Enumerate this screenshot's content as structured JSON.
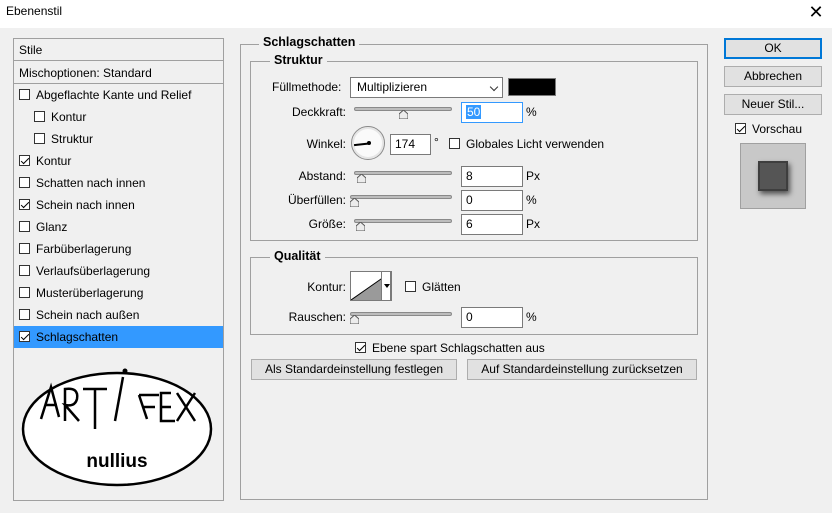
{
  "window": {
    "title": "Ebenenstil",
    "close_icon": "close-icon"
  },
  "style_list": {
    "header": "Stile",
    "blending": "Mischoptionen: Standard",
    "items": [
      {
        "label": "Abgeflachte Kante und Relief",
        "checked": false,
        "indent": false,
        "selected": false
      },
      {
        "label": "Kontur",
        "checked": false,
        "indent": true,
        "selected": false
      },
      {
        "label": "Struktur",
        "checked": false,
        "indent": true,
        "selected": false
      },
      {
        "label": "Kontur",
        "checked": true,
        "indent": false,
        "selected": false
      },
      {
        "label": "Schatten nach innen",
        "checked": false,
        "indent": false,
        "selected": false
      },
      {
        "label": "Schein nach innen",
        "checked": true,
        "indent": false,
        "selected": false
      },
      {
        "label": "Glanz",
        "checked": false,
        "indent": false,
        "selected": false
      },
      {
        "label": "Farbüberlagerung",
        "checked": false,
        "indent": false,
        "selected": false
      },
      {
        "label": "Verlaufsüberlagerung",
        "checked": false,
        "indent": false,
        "selected": false
      },
      {
        "label": "Musterüberlagerung",
        "checked": false,
        "indent": false,
        "selected": false
      },
      {
        "label": "Schein nach außen",
        "checked": false,
        "indent": false,
        "selected": false
      },
      {
        "label": "Schlagschatten",
        "checked": true,
        "indent": false,
        "selected": true
      }
    ],
    "logo": {
      "line1": "ART",
      "line2": "FEX",
      "line3": "nullius"
    }
  },
  "panel": {
    "title": "Schlagschatten",
    "structure": {
      "title": "Struktur",
      "blend_mode_label": "Füllmethode:",
      "blend_mode_value": "Multiplizieren",
      "shadow_color": "#000000",
      "opacity_label": "Deckkraft:",
      "opacity_value": "50",
      "opacity_unit": "%",
      "opacity_level": 50,
      "angle_label": "Winkel:",
      "angle_value": "174",
      "angle_unit": "°",
      "global_light_label": "Globales Licht verwenden",
      "global_light_checked": false,
      "distance_label": "Abstand:",
      "distance_value": "8",
      "distance_unit": "Px",
      "spread_label": "Überfüllen:",
      "spread_value": "0",
      "spread_unit": "%",
      "size_label": "Größe:",
      "size_value": "6",
      "size_unit": "Px"
    },
    "quality": {
      "title": "Qualität",
      "contour_label": "Kontur:",
      "antialias_label": "Glätten",
      "antialias_checked": false,
      "noise_label": "Rauschen:",
      "noise_value": "0",
      "noise_unit": "%"
    },
    "knockout_label": "Ebene spart Schlagschatten aus",
    "knockout_checked": true,
    "make_default": "Als Standardeinstellung festlegen",
    "reset_default": "Auf Standardeinstellung zurücksetzen"
  },
  "buttons": {
    "ok": "OK",
    "cancel": "Abbrechen",
    "new_style": "Neuer Stil...",
    "preview_label": "Vorschau",
    "preview_checked": true
  }
}
